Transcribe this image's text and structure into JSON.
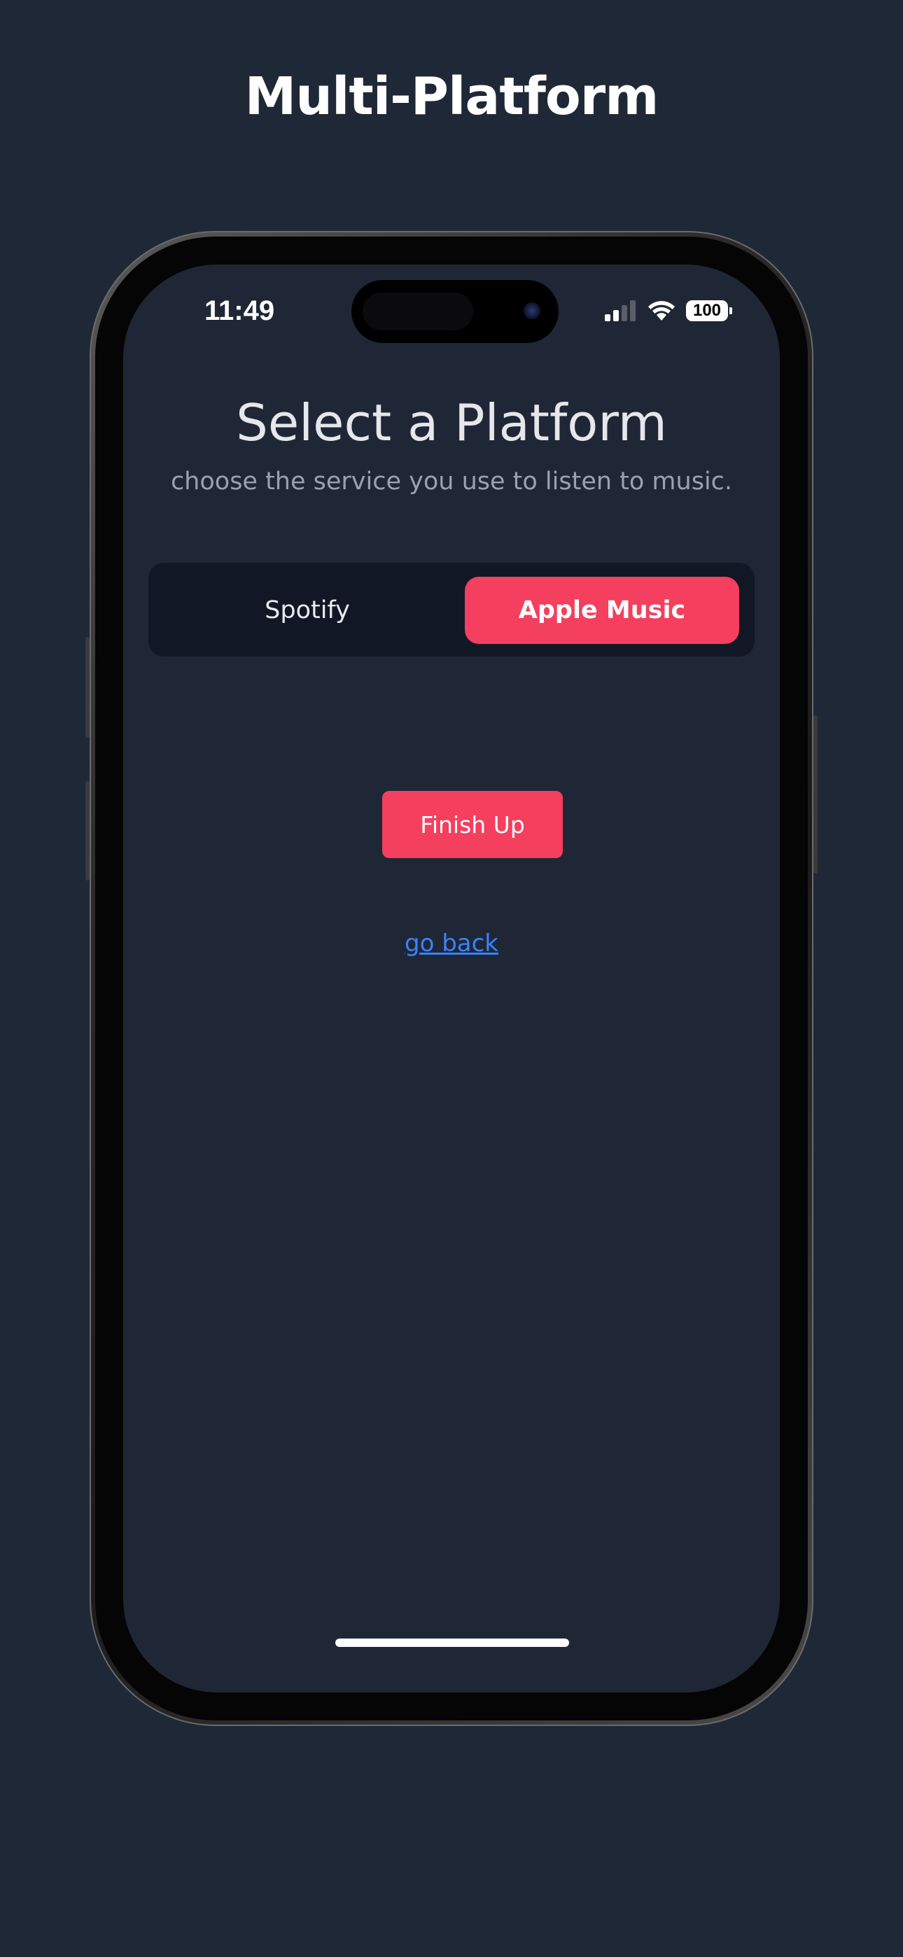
{
  "headline": "Multi-Platform",
  "status_bar": {
    "time": "11:49",
    "battery": "100",
    "icons": [
      "cellular-signal-icon",
      "wifi-icon",
      "battery-icon"
    ]
  },
  "screen": {
    "title": "Select a Platform",
    "subtitle": "choose the service you use to listen to music.",
    "platform_selector": {
      "options": [
        {
          "label": "Spotify",
          "selected": false
        },
        {
          "label": "Apple Music",
          "selected": true
        }
      ]
    },
    "finish_label": "Finish Up",
    "back_label": "go back"
  },
  "colors": {
    "background": "#1f2836",
    "screen": "#1f2737",
    "segmented_bg": "#121726",
    "accent": "#f43f5e",
    "link": "#3b82f6",
    "title": "#e5e7eb",
    "subtitle": "#9aa2af"
  }
}
